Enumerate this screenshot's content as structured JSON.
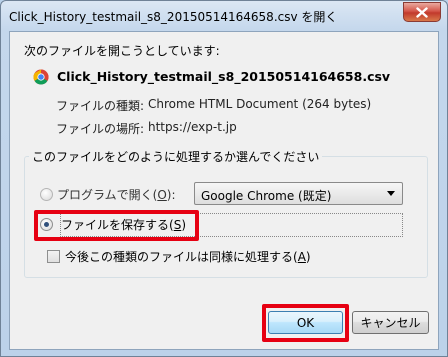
{
  "window": {
    "title": "Click_History_testmail_s8_20150514164658.csv を開く"
  },
  "dialog": {
    "prompt": "次のファイルを開こうとしています:",
    "file_icon": "chrome-icon",
    "filename": "Click_History_testmail_s8_20150514164658.csv",
    "type_label": "ファイルの種類:",
    "type_value": "Chrome HTML Document (264 bytes)",
    "from_label": "ファイルの場所:",
    "from_value": "https://exp-t.jp"
  },
  "action_group": {
    "legend": "このファイルをどのように処理するか選んでください",
    "open_with": {
      "label_prefix": "プログラムで開く(",
      "accesskey": "O",
      "label_suffix": "):",
      "selected": false
    },
    "app_select": {
      "value": "Google Chrome (既定)"
    },
    "save_file": {
      "label_prefix": "ファイルを保存する(",
      "accesskey": "S",
      "label_suffix": ")",
      "selected": true
    }
  },
  "remember": {
    "label_prefix": "今後この種類のファイルは同様に処理する(",
    "accesskey": "A",
    "label_suffix": ")",
    "checked": false
  },
  "buttons": {
    "ok": "OK",
    "cancel": "キャンセル"
  },
  "colors": {
    "highlight": "#e60012",
    "titlebar": "#c4d7ec",
    "client_bg": "#f0f0f0",
    "close_button": "#c13a2c"
  }
}
